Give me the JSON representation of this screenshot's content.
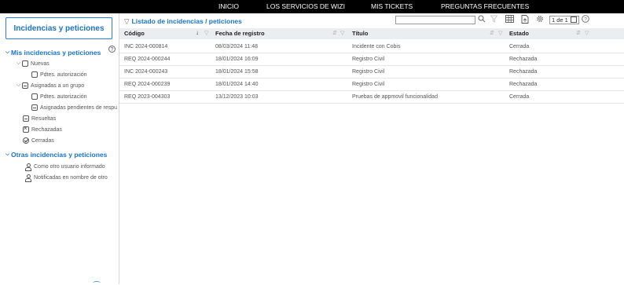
{
  "topnav": {
    "items": [
      "INICIO",
      "LOS SERVICIOS DE WIZI",
      "MIS TICKETS",
      "PREGUNTAS FRECUENTES"
    ]
  },
  "sidebar": {
    "title": "Incidencias y peticiones",
    "help_glyph": "?",
    "sections": {
      "mine": "Mis incidencias y peticiones",
      "nuevas": "Nuevas",
      "nuevas_pdtes": "Pdtes. autorización",
      "asignadas": "Asignadas a un grupo",
      "asignadas_pdtes": "Pdtes. autorización",
      "asignadas_pend": "Asignadas pendientes de respu",
      "resueltas": "Resueltas",
      "rechazadas": "Rechazadas",
      "cerradas": "Cerradas",
      "others": "Otras incidencias y peticiones",
      "otro_usuario": "Como otro usuario informado",
      "notificadas": "Notificadas en nombre de otro"
    }
  },
  "main": {
    "title": "Listado de incidencias / peticiones",
    "search": {
      "value": "",
      "placeholder": ""
    },
    "pager": "1 de 1",
    "icons": [
      "search-icon",
      "filter-icon",
      "grid-icon",
      "export-icon",
      "gear-icon",
      "help-icon"
    ],
    "columns": [
      "Código",
      "Fecha de registro",
      "Título",
      "Estado"
    ],
    "rows": [
      [
        "INC 2024-000814",
        "08/03/2024 11:48",
        "Incidente con Cobis",
        "Cerrada"
      ],
      [
        "REQ 2024-000244",
        "18/01/2024 16:09",
        "Registro Civil",
        "Rechazada"
      ],
      [
        "INC 2024-000243",
        "18/01/2024 15:58",
        "Registro Civil",
        "Rechazada"
      ],
      [
        "REQ 2024-000239",
        "18/01/2024 14:40",
        "Registro Civil",
        "Rechazada"
      ],
      [
        "REQ 2023-004303",
        "13/12/2023 10:03",
        "Pruebas de appmovil funcionalidad",
        "Cerrada"
      ]
    ]
  },
  "colors": {
    "accent": "#1a73c7",
    "header_bg": "#ebeef1",
    "topbar": "#000000"
  }
}
